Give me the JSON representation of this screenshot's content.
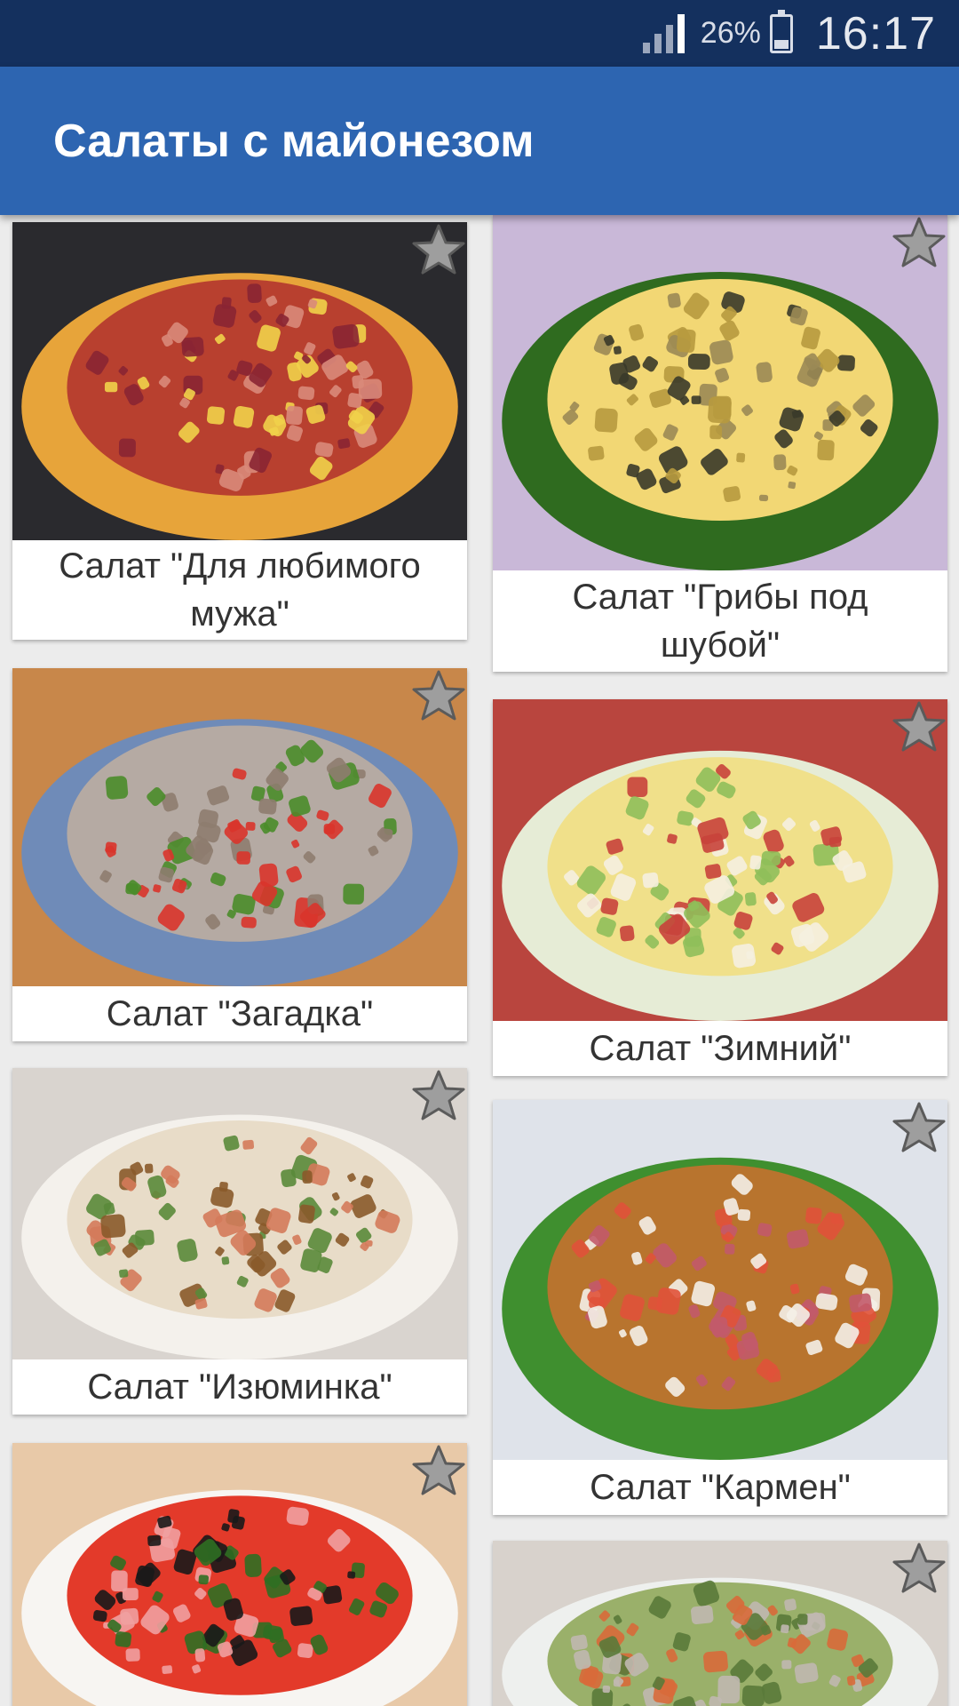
{
  "status_bar": {
    "battery": "26%",
    "time": "16:17"
  },
  "app_bar": {
    "title": "Салаты с майонезом"
  },
  "recipes": [
    {
      "title": "Салат \"Для любимого мужа\"",
      "favorite": false,
      "photo_colors": [
        "#2a2a2e",
        "#e7a43a",
        "#b8402f",
        "#8a2533",
        "#f1d24a",
        "#d98a7a"
      ]
    },
    {
      "title": "Салат \"Грибы под шубой\"",
      "favorite": false,
      "photo_colors": [
        "#c9b8d8",
        "#2f6b1f",
        "#f2d774",
        "#3a3a2a",
        "#9b8a55",
        "#b79a3f"
      ]
    },
    {
      "title": "Салат \"Загадка\"",
      "favorite": false,
      "photo_colors": [
        "#c8874a",
        "#6f8bb8",
        "#b5aaa3",
        "#d9342b",
        "#4a8c2a",
        "#8e7c6f"
      ]
    },
    {
      "title": "Салат \"Зимний\"",
      "favorite": false,
      "photo_colors": [
        "#b9453e",
        "#e6ecd6",
        "#f0e08a",
        "#8fbf5a",
        "#c8433b",
        "#f5f0e0"
      ]
    },
    {
      "title": "Салат \"Изюминка\"",
      "favorite": false,
      "photo_colors": [
        "#d9d4cf",
        "#f4f1ec",
        "#e8dcc8",
        "#8a5a2a",
        "#5a8a3a",
        "#d47a5a"
      ]
    },
    {
      "title": "Салат \"Кармен\"",
      "favorite": false,
      "photo_colors": [
        "#dfe3ea",
        "#3f8f2f",
        "#b8742e",
        "#e0523a",
        "#f4efe8",
        "#c25a6a"
      ]
    },
    {
      "title": "",
      "favorite": false,
      "photo_colors": [
        "#e8c9a8",
        "#f7f5f2",
        "#e33a2a",
        "#2f6f22",
        "#1a1a1a",
        "#f0a0a0"
      ]
    },
    {
      "title": "",
      "favorite": false,
      "photo_colors": [
        "#d8d2cc",
        "#eef0ee",
        "#9ab06a",
        "#d86a3a",
        "#5a7a3a",
        "#c0b8b0"
      ]
    }
  ]
}
